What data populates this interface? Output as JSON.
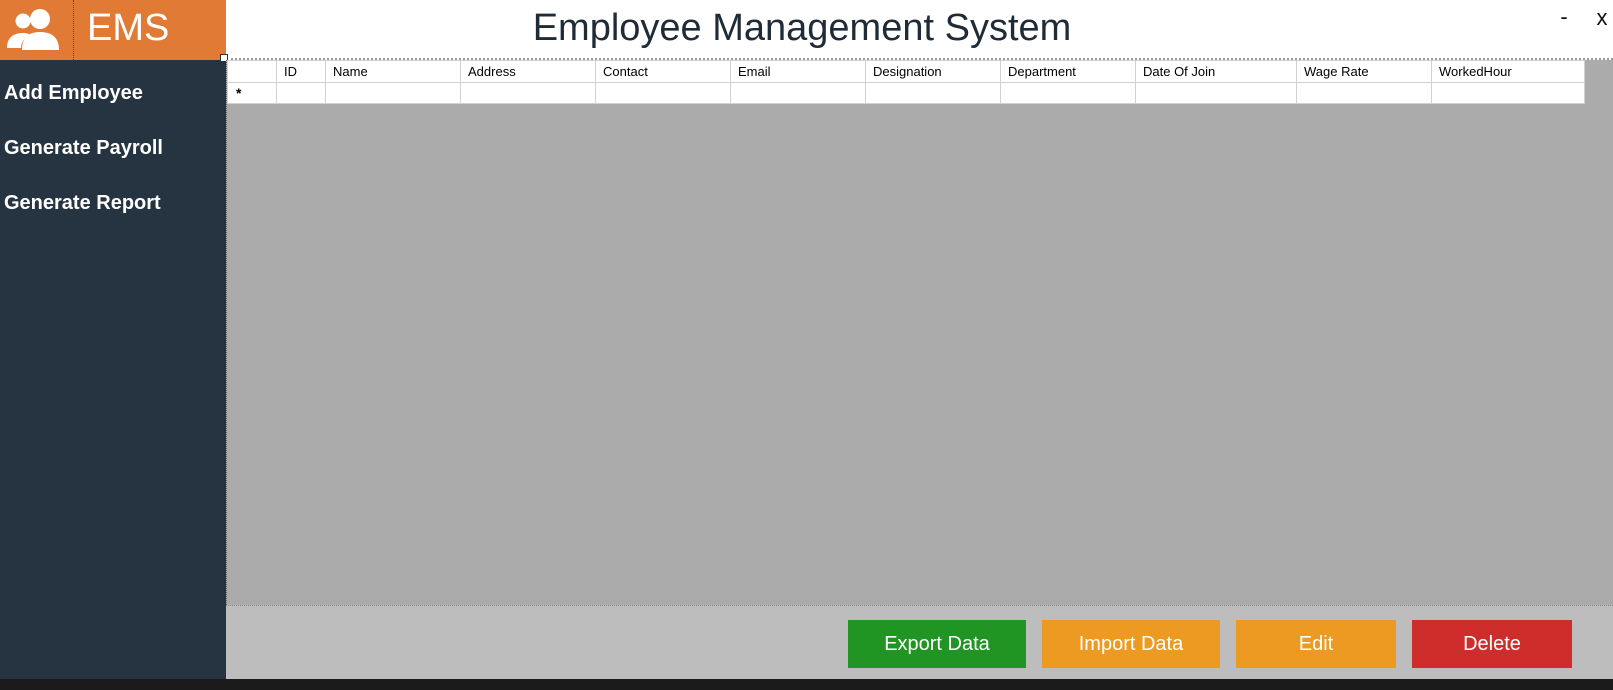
{
  "app": {
    "logo_text": "EMS",
    "title": "Employee Management System",
    "window_controls": {
      "minimize": "-",
      "close": "x"
    }
  },
  "sidebar": {
    "items": [
      {
        "label": "Add Employee"
      },
      {
        "label": "Generate Payroll"
      },
      {
        "label": "Generate Report"
      }
    ]
  },
  "grid": {
    "columns": [
      "ID",
      "Name",
      "Address",
      "Contact",
      "Email",
      "Designation",
      "Department",
      "Date Of Join",
      "Wage Rate",
      "WorkedHour"
    ],
    "new_row_marker": "*",
    "rows": []
  },
  "actions": {
    "export_label": "Export Data",
    "import_label": "Import Data",
    "edit_label": "Edit",
    "delete_label": "Delete"
  },
  "colors": {
    "brand_orange": "#e07a34",
    "sidebar_bg": "#263340",
    "export_green": "#219524",
    "import_orange": "#ec9a22",
    "edit_orange": "#ec9a22",
    "delete_red": "#cf2c2c"
  },
  "icons": {
    "logo": "users-icon"
  }
}
